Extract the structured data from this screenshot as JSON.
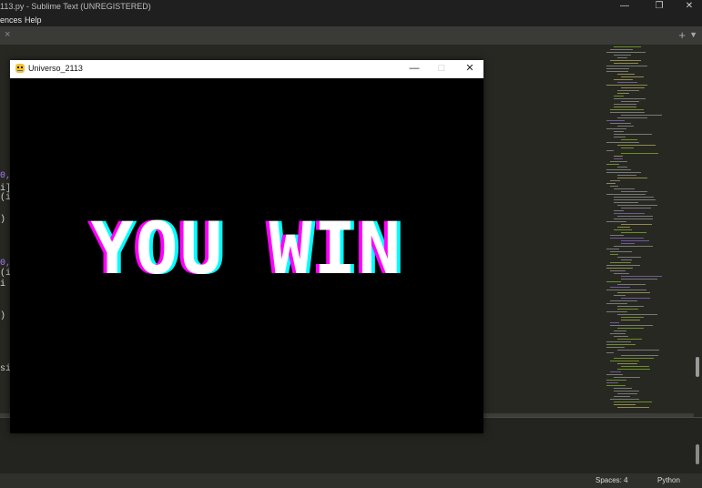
{
  "editor": {
    "window_title": "113.py - Sublime Text (UNREGISTERED)",
    "menu": [
      "ences",
      "Help"
    ],
    "tab_close": "×",
    "tab_add": "+",
    "tab_dropdown": "▼",
    "code_fragments": [
      {
        "text": "0,"
      },
      {
        "text": "i]"
      },
      {
        "text": "(i"
      },
      {
        "text": ")"
      },
      {
        "text": "0,"
      },
      {
        "text": "(i"
      },
      {
        "text": "i"
      },
      {
        "text": ")"
      },
      {
        "text": "si"
      }
    ],
    "status": {
      "indent": "Spaces: 4",
      "syntax": "Python"
    },
    "accent_colors": {
      "purple": "#ae81ff",
      "background": "#272822"
    }
  },
  "game": {
    "title": "Universo_2113",
    "message": "YOU WIN",
    "controls": {
      "minimize": "—",
      "maximize": "□",
      "close": "✕"
    }
  }
}
